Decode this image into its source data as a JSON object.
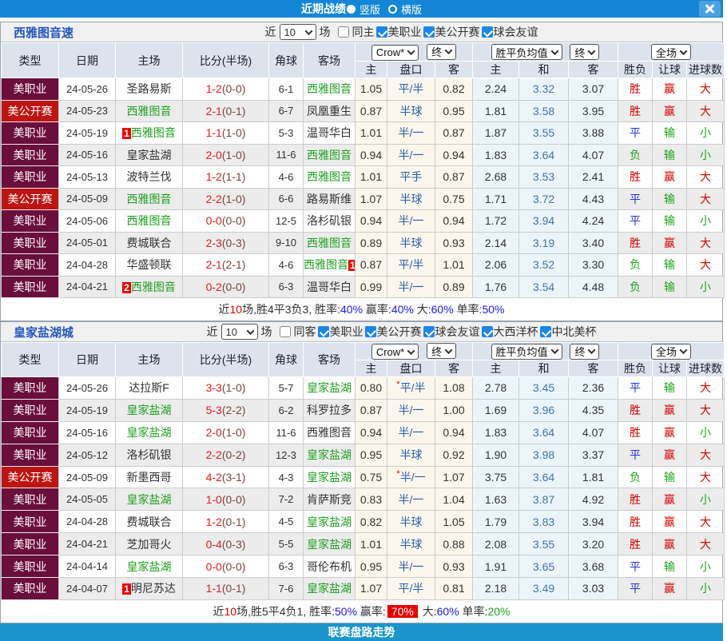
{
  "colors": {
    "topbar": "#1486d8",
    "bottombar": "#1b95cc",
    "league_mls": "#6a0e3c",
    "league_open": "#bd1413",
    "team_green": "#1fa11f",
    "score_red": "#e81b1b",
    "win_red": "#d40000",
    "draw_blue": "#2233cc",
    "lose_green": "#1ca41c"
  },
  "top_bar": {
    "title": "近期战绩",
    "radios": [
      {
        "label": "竖版",
        "selected": true
      },
      {
        "label": "横版",
        "selected": false
      }
    ]
  },
  "bottom_bar": {
    "label": "联赛盘路走势"
  },
  "sections": [
    {
      "team": "西雅图音速",
      "filters": {
        "prefix": "近",
        "count": "10",
        "suffix": "场",
        "same": {
          "label": "同主",
          "checked": false
        },
        "leagues": [
          {
            "label": "美职业",
            "checked": true
          },
          {
            "label": "美公开赛",
            "checked": true
          },
          {
            "label": "球会友谊",
            "checked": true
          }
        ]
      },
      "table": {
        "left_headers": [
          "类型",
          "日期",
          "主场",
          "比分(半场)",
          "角球",
          "客场"
        ],
        "selects": {
          "odds": "Crow*",
          "odds_final": "终",
          "avg": "胜平负均值",
          "avg_final": "终",
          "scope": "全场"
        },
        "sub_headers": [
          "主",
          "盘口",
          "客",
          "主",
          "和",
          "客",
          "胜负",
          "让球",
          "进球数"
        ]
      },
      "rows": [
        {
          "league": "美职业",
          "type": "mls",
          "date": "24-05-26",
          "home": "圣路易斯",
          "home_green": false,
          "home_badge": "",
          "score": "1-2",
          "half": "(0-0)",
          "corner": "6-1",
          "away": "西雅图音",
          "away_green": true,
          "away_badge": "",
          "o_home": "1.05",
          "handicap": "平/半",
          "star": false,
          "o_away": "0.82",
          "avg": [
            "2.24",
            "3.32",
            "3.07"
          ],
          "res": [
            "胜",
            "赢",
            "大"
          ]
        },
        {
          "league": "美公开赛",
          "type": "open",
          "date": "24-05-23",
          "home": "西雅图音",
          "home_green": true,
          "home_badge": "",
          "score": "2-1",
          "half": "(0-1)",
          "corner": "6-7",
          "away": "凤凰重生",
          "away_green": false,
          "away_badge": "",
          "o_home": "0.87",
          "handicap": "半球",
          "star": false,
          "o_away": "0.95",
          "avg": [
            "1.81",
            "3.58",
            "3.95"
          ],
          "res": [
            "胜",
            "赢",
            "大"
          ]
        },
        {
          "league": "美职业",
          "type": "mls",
          "date": "24-05-19",
          "home": "西雅图音",
          "home_green": true,
          "home_badge": "1",
          "score": "1-1",
          "half": "(1-0)",
          "corner": "5-3",
          "away": "温哥华白",
          "away_green": false,
          "away_badge": "",
          "o_home": "1.01",
          "handicap": "半/一",
          "star": false,
          "o_away": "0.87",
          "avg": [
            "1.87",
            "3.55",
            "3.88"
          ],
          "res": [
            "平",
            "输",
            "小"
          ]
        },
        {
          "league": "美职业",
          "type": "mls",
          "date": "24-05-16",
          "home": "皇家盐湖",
          "home_green": false,
          "home_badge": "",
          "score": "2-0",
          "half": "(1-0)",
          "corner": "11-6",
          "away": "西雅图音",
          "away_green": true,
          "away_badge": "",
          "o_home": "0.94",
          "handicap": "半/一",
          "star": false,
          "o_away": "0.94",
          "avg": [
            "1.83",
            "3.64",
            "4.07"
          ],
          "res": [
            "负",
            "输",
            "小"
          ]
        },
        {
          "league": "美职业",
          "type": "mls",
          "date": "24-05-13",
          "home": "波特兰伐",
          "home_green": false,
          "home_badge": "",
          "score": "1-2",
          "half": "(1-1)",
          "corner": "4-6",
          "away": "西雅图音",
          "away_green": true,
          "away_badge": "",
          "o_home": "1.01",
          "handicap": "平手",
          "star": false,
          "o_away": "0.87",
          "avg": [
            "2.68",
            "3.53",
            "2.41"
          ],
          "res": [
            "胜",
            "赢",
            "大"
          ]
        },
        {
          "league": "美公开赛",
          "type": "open",
          "date": "24-05-09",
          "home": "西雅图音",
          "home_green": true,
          "home_badge": "",
          "score": "2-2",
          "half": "(1-0)",
          "corner": "6-6",
          "away": "路易斯维",
          "away_green": false,
          "away_badge": "",
          "o_home": "1.07",
          "handicap": "半球",
          "star": false,
          "o_away": "0.75",
          "avg": [
            "1.71",
            "3.72",
            "4.43"
          ],
          "res": [
            "平",
            "输",
            "大"
          ]
        },
        {
          "league": "美职业",
          "type": "mls",
          "date": "24-05-06",
          "home": "西雅图音",
          "home_green": true,
          "home_badge": "",
          "score": "0-0",
          "half": "(0-0)",
          "corner": "12-5",
          "away": "洛杉矶银",
          "away_green": false,
          "away_badge": "",
          "o_home": "0.94",
          "handicap": "半/一",
          "star": false,
          "o_away": "0.94",
          "avg": [
            "1.72",
            "3.94",
            "4.24"
          ],
          "res": [
            "平",
            "输",
            "小"
          ]
        },
        {
          "league": "美职业",
          "type": "mls",
          "date": "24-05-01",
          "home": "费城联合",
          "home_green": false,
          "home_badge": "",
          "score": "2-3",
          "half": "(0-3)",
          "corner": "9-10",
          "away": "西雅图音",
          "away_green": true,
          "away_badge": "",
          "o_home": "0.89",
          "handicap": "半球",
          "star": false,
          "o_away": "0.93",
          "avg": [
            "2.14",
            "3.19",
            "3.40"
          ],
          "res": [
            "胜",
            "赢",
            "大"
          ]
        },
        {
          "league": "美职业",
          "type": "mls",
          "date": "24-04-28",
          "home": "华盛顿联",
          "home_green": false,
          "home_badge": "",
          "score": "2-1",
          "half": "(2-1)",
          "corner": "4-6",
          "away": "西雅图音",
          "away_green": true,
          "away_badge": "1",
          "badge_after": true,
          "o_home": "0.87",
          "handicap": "平/半",
          "star": false,
          "o_away": "1.01",
          "avg": [
            "2.06",
            "3.52",
            "3.30"
          ],
          "res": [
            "负",
            "输",
            "大"
          ]
        },
        {
          "league": "美职业",
          "type": "mls",
          "date": "24-04-21",
          "home": "西雅图音",
          "home_green": true,
          "home_badge": "2",
          "score": "0-2",
          "half": "(0-0)",
          "corner": "6-3",
          "away": "温哥华白",
          "away_green": false,
          "away_badge": "",
          "o_home": "0.99",
          "handicap": "半/一",
          "star": false,
          "o_away": "0.89",
          "avg": [
            "1.76",
            "3.54",
            "4.48"
          ],
          "res": [
            "负",
            "输",
            "小"
          ]
        }
      ],
      "summary": [
        {
          "text": "近",
          "c": "k"
        },
        {
          "text": "10",
          "c": "r"
        },
        {
          "text": "场,胜4平3负3, 胜率:",
          "c": "k"
        },
        {
          "text": "40%",
          "c": "bl"
        },
        {
          "text": " 赢率:",
          "c": "k"
        },
        {
          "text": "40%",
          "c": "bl"
        },
        {
          "text": " 大:",
          "c": "k"
        },
        {
          "text": "60%",
          "c": "bl"
        },
        {
          "text": " 单率:",
          "c": "k"
        },
        {
          "text": "50%",
          "c": "bl"
        }
      ]
    },
    {
      "team": "皇家盐湖城",
      "filters": {
        "prefix": "近",
        "count": "10",
        "suffix": "场",
        "same": {
          "label": "同客",
          "checked": false
        },
        "leagues": [
          {
            "label": "美职业",
            "checked": true
          },
          {
            "label": "美公开赛",
            "checked": true
          },
          {
            "label": "球会友谊",
            "checked": true
          },
          {
            "label": "大西洋杯",
            "checked": true
          },
          {
            "label": "中北美杯",
            "checked": true
          }
        ]
      },
      "table": {
        "left_headers": [
          "类型",
          "日期",
          "主场",
          "比分(半场)",
          "角球",
          "客场"
        ],
        "selects": {
          "odds": "Crow*",
          "odds_final": "终",
          "avg": "胜平负均值",
          "avg_final": "终",
          "scope": "全场"
        },
        "sub_headers": [
          "主",
          "盘口",
          "客",
          "主",
          "和",
          "客",
          "胜负",
          "让球",
          "进球数"
        ]
      },
      "rows": [
        {
          "league": "美职业",
          "type": "mls",
          "date": "24-05-26",
          "home": "达拉斯F",
          "home_green": false,
          "home_badge": "",
          "score": "3-3",
          "half": "(1-0)",
          "corner": "5-7",
          "away": "皇家盐湖",
          "away_green": true,
          "away_badge": "",
          "o_home": "0.80",
          "handicap": "平/半",
          "star": true,
          "o_away": "1.08",
          "avg": [
            "2.78",
            "3.45",
            "2.36"
          ],
          "res": [
            "平",
            "输",
            "大"
          ]
        },
        {
          "league": "美职业",
          "type": "mls",
          "date": "24-05-19",
          "home": "皇家盐湖",
          "home_green": true,
          "home_badge": "",
          "score": "5-3",
          "half": "(2-2)",
          "corner": "6-2",
          "away": "科罗拉多",
          "away_green": false,
          "away_badge": "",
          "o_home": "0.87",
          "handicap": "半/一",
          "star": false,
          "o_away": "1.00",
          "avg": [
            "1.69",
            "3.96",
            "4.35"
          ],
          "res": [
            "胜",
            "赢",
            "大"
          ]
        },
        {
          "league": "美职业",
          "type": "mls",
          "date": "24-05-16",
          "home": "皇家盐湖",
          "home_green": true,
          "home_badge": "",
          "score": "2-0",
          "half": "(1-0)",
          "corner": "11-6",
          "away": "西雅图音",
          "away_green": false,
          "away_badge": "",
          "o_home": "0.94",
          "handicap": "半/一",
          "star": false,
          "o_away": "0.94",
          "avg": [
            "1.83",
            "3.64",
            "4.07"
          ],
          "res": [
            "胜",
            "赢",
            "小"
          ]
        },
        {
          "league": "美职业",
          "type": "mls",
          "date": "24-05-12",
          "home": "洛杉矶银",
          "home_green": false,
          "home_badge": "",
          "score": "2-2",
          "half": "(0-2)",
          "corner": "12-3",
          "away": "皇家盐湖",
          "away_green": true,
          "away_badge": "",
          "o_home": "0.95",
          "handicap": "半球",
          "star": false,
          "o_away": "0.92",
          "avg": [
            "1.90",
            "3.98",
            "3.37"
          ],
          "res": [
            "平",
            "赢",
            "大"
          ]
        },
        {
          "league": "美公开赛",
          "type": "open",
          "date": "24-05-09",
          "home": "新墨西哥",
          "home_green": false,
          "home_badge": "",
          "score": "4-2",
          "half": "(3-1)",
          "corner": "4-3",
          "away": "皇家盐湖",
          "away_green": true,
          "away_badge": "",
          "o_home": "0.75",
          "handicap": "半/一",
          "star": true,
          "o_away": "1.07",
          "avg": [
            "3.75",
            "3.64",
            "1.81"
          ],
          "res": [
            "负",
            "输",
            "大"
          ]
        },
        {
          "league": "美职业",
          "type": "mls",
          "date": "24-05-05",
          "home": "皇家盐湖",
          "home_green": true,
          "home_badge": "",
          "score": "1-0",
          "half": "(0-0)",
          "corner": "7-2",
          "away": "肯萨斯竞",
          "away_green": false,
          "away_badge": "",
          "o_home": "0.83",
          "handicap": "半/一",
          "star": false,
          "o_away": "1.04",
          "avg": [
            "1.63",
            "3.87",
            "4.92"
          ],
          "res": [
            "胜",
            "赢",
            "小"
          ]
        },
        {
          "league": "美职业",
          "type": "mls",
          "date": "24-04-28",
          "home": "费城联合",
          "home_green": false,
          "home_badge": "",
          "score": "1-2",
          "half": "(0-1)",
          "corner": "4-5",
          "away": "皇家盐湖",
          "away_green": true,
          "away_badge": "",
          "o_home": "0.82",
          "handicap": "半球",
          "star": false,
          "o_away": "1.05",
          "avg": [
            "1.79",
            "3.83",
            "3.94"
          ],
          "res": [
            "胜",
            "赢",
            "大"
          ]
        },
        {
          "league": "美职业",
          "type": "mls",
          "date": "24-04-21",
          "home": "芝加哥火",
          "home_green": false,
          "home_badge": "",
          "score": "0-4",
          "half": "(0-3)",
          "corner": "5-5",
          "away": "皇家盐湖",
          "away_green": true,
          "away_badge": "",
          "o_home": "1.01",
          "handicap": "半球",
          "star": false,
          "o_away": "0.88",
          "avg": [
            "2.08",
            "3.55",
            "3.20"
          ],
          "res": [
            "胜",
            "赢",
            "大"
          ]
        },
        {
          "league": "美职业",
          "type": "mls",
          "date": "24-04-14",
          "home": "皇家盐湖",
          "home_green": true,
          "home_badge": "",
          "score": "0-0",
          "half": "(0-0)",
          "corner": "6-3",
          "away": "哥伦布机",
          "away_green": false,
          "away_badge": "",
          "o_home": "0.95",
          "handicap": "半/一",
          "star": false,
          "o_away": "0.93",
          "avg": [
            "1.91",
            "3.65",
            "3.68"
          ],
          "res": [
            "平",
            "输",
            "小"
          ]
        },
        {
          "league": "美职业",
          "type": "mls",
          "date": "24-04-07",
          "home": "明尼苏达",
          "home_green": false,
          "home_badge": "1",
          "score": "1-1",
          "half": "(0-1)",
          "corner": "7-6",
          "away": "皇家盐湖",
          "away_green": true,
          "away_badge": "",
          "o_home": "1.07",
          "handicap": "平/半",
          "star": false,
          "o_away": "0.81",
          "avg": [
            "2.18",
            "3.49",
            "3.03"
          ],
          "res": [
            "平",
            "赢",
            "小"
          ]
        }
      ],
      "summary": [
        {
          "text": "近",
          "c": "k"
        },
        {
          "text": "10",
          "c": "r"
        },
        {
          "text": "场,胜5平4负1, 胜率:",
          "c": "k"
        },
        {
          "text": "50%",
          "c": "bl"
        },
        {
          "text": " 赢率:",
          "c": "k"
        },
        {
          "text": "70%",
          "c": "w"
        },
        {
          "text": " 大:",
          "c": "k"
        },
        {
          "text": "60%",
          "c": "bl"
        },
        {
          "text": " 单率:",
          "c": "k"
        },
        {
          "text": "20%",
          "c": "g"
        }
      ]
    }
  ]
}
